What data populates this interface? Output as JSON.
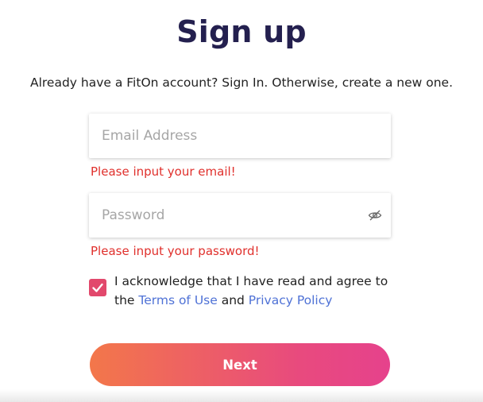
{
  "form": {
    "title": "Sign up",
    "subtitle": "Already have a FitOn account? Sign In. Otherwise, create a new one.",
    "email": {
      "placeholder": "Email Address",
      "value": "",
      "error": "Please input your email!"
    },
    "password": {
      "placeholder": "Password",
      "value": "",
      "error": "Please input your password!",
      "toggle_icon": "eye-slash-icon"
    },
    "agreement": {
      "checked": true,
      "text_before": "I acknowledge that I have read and agree to the ",
      "terms_link": "Terms of Use",
      "and_text": " and ",
      "privacy_link": "Privacy Policy",
      "check_icon": "checkmark-icon"
    },
    "next_label": "Next"
  },
  "colors": {
    "title": "#24204f",
    "error": "#e0302c",
    "link": "#4f72d6",
    "checkbox": "#e2486c",
    "button_gradient_start": "#f3774a",
    "button_gradient_end": "#e6428c"
  }
}
